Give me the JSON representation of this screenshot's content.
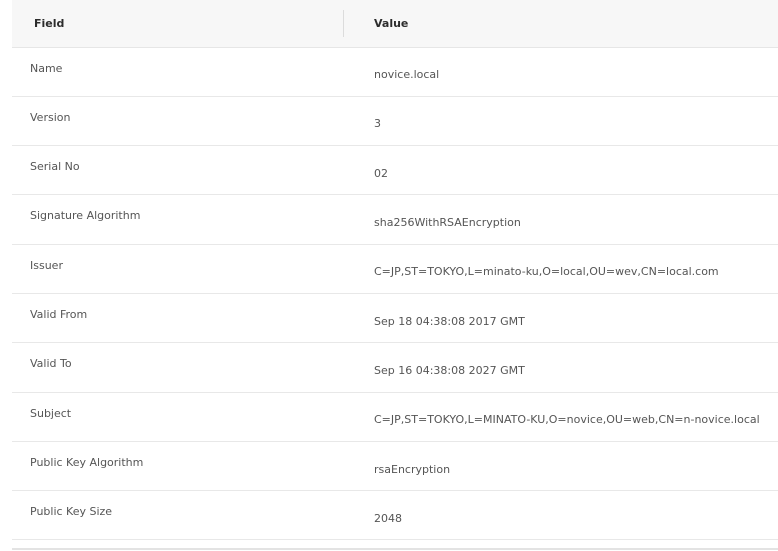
{
  "table": {
    "headers": {
      "field": "Field",
      "value": "Value"
    },
    "rows": [
      {
        "field": "Name",
        "value": "novice.local"
      },
      {
        "field": "Version",
        "value": "3"
      },
      {
        "field": "Serial No",
        "value": "02"
      },
      {
        "field": "Signature Algorithm",
        "value": "sha256WithRSAEncryption"
      },
      {
        "field": "Issuer",
        "value": "C=JP,ST=TOKYO,L=minato-ku,O=local,OU=wev,CN=local.com"
      },
      {
        "field": "Valid From",
        "value": "Sep 18 04:38:08 2017 GMT"
      },
      {
        "field": "Valid To",
        "value": "Sep 16 04:38:08 2027 GMT"
      },
      {
        "field": "Subject",
        "value": "C=JP,ST=TOKYO,L=MINATO-KU,O=novice,OU=web,CN=n-novice.local"
      },
      {
        "field": "Public Key Algorithm",
        "value": "rsaEncryption"
      },
      {
        "field": "Public Key Size",
        "value": "2048"
      }
    ]
  }
}
